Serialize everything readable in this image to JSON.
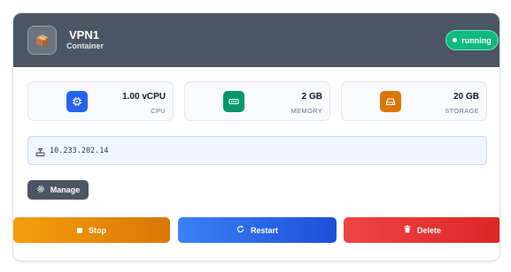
{
  "container": {
    "name": "VPN1",
    "type_label": "Container",
    "status": "running",
    "icon": "package-icon"
  },
  "stats": {
    "cpu": {
      "value": "1.00 vCPU",
      "label": "CPU",
      "icon": "cpu-icon",
      "color": "#2563eb"
    },
    "memory": {
      "value": "2 GB",
      "label": "MEMORY",
      "icon": "memory-icon",
      "color": "#059669"
    },
    "storage": {
      "value": "20 GB",
      "label": "STORAGE",
      "icon": "storage-icon",
      "color": "#d97706"
    }
  },
  "network": {
    "ip": "10.233.202.14",
    "icon": "network-icon"
  },
  "actions": {
    "manage_label": "Manage",
    "stop_label": "Stop",
    "restart_label": "Restart",
    "delete_label": "Delete"
  },
  "colors": {
    "header_bg": "#4b5563",
    "status_running": "#10b981",
    "stop": "#f59e0b",
    "restart": "#3b82f6",
    "delete": "#ef4444"
  }
}
